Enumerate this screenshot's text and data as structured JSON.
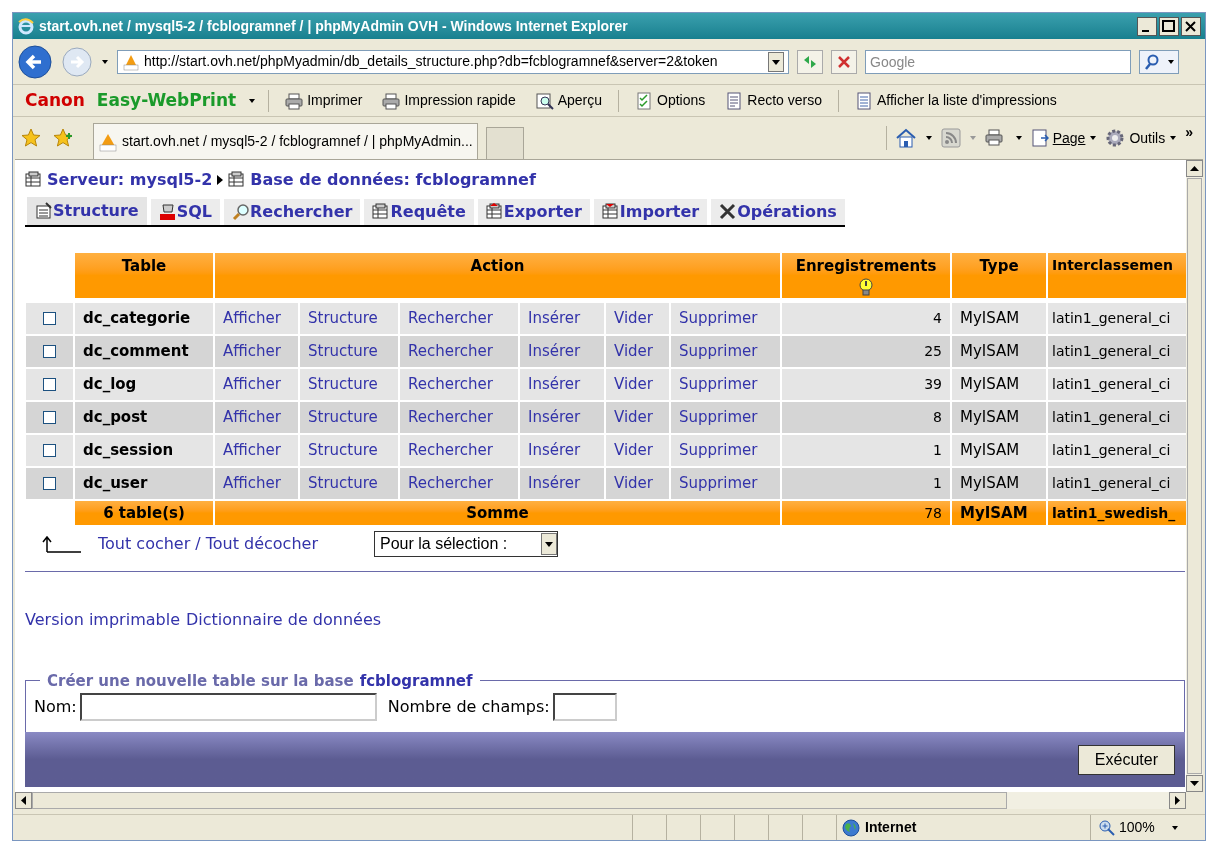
{
  "window": {
    "title": "start.ovh.net / mysql5-2 / fcblogramnef / | phpMyAdmin OVH - Windows Internet Explorer"
  },
  "address_bar": {
    "url": "http://start.ovh.net/phpMyadmin/db_details_structure.php?db=fcblogramnef&server=2&token"
  },
  "search": {
    "placeholder": "Google"
  },
  "print_toolbar": {
    "brand": "Canon",
    "product": "Easy-WebPrint",
    "buttons": [
      "Imprimer",
      "Impression rapide",
      "Aperçu",
      "Options",
      "Recto verso",
      "Afficher la liste d'impressions"
    ]
  },
  "browser_tabs": [
    {
      "label": "start.ovh.net / mysql5-2 / fcblogramnef / | phpMyAdmin...",
      "selected": true
    }
  ],
  "command_bar": {
    "page": "Page",
    "tools": "Outils",
    "more": "»"
  },
  "breadcrumb": {
    "server": "Serveur: mysql5-2",
    "database": "Base de données: fcblogramnef"
  },
  "pma_tabs": [
    {
      "label": "Structure",
      "selected": true
    },
    {
      "label": "SQL",
      "selected": false
    },
    {
      "label": "Rechercher",
      "selected": false
    },
    {
      "label": "Requête",
      "selected": false
    },
    {
      "label": "Exporter",
      "selected": false
    },
    {
      "label": "Importer",
      "selected": false
    },
    {
      "label": "Opérations",
      "selected": false
    }
  ],
  "table": {
    "columns": [
      "Table",
      "Action",
      "Enregistrements",
      "Type",
      "Interclassemen"
    ],
    "rows": [
      {
        "checked": false,
        "name": "dc_categorie",
        "actions": [
          "Afficher",
          "Structure",
          "Rechercher",
          "Insérer",
          "Vider",
          "Supprimer"
        ],
        "records": "4",
        "type": "MyISAM",
        "collation": "latin1_general_ci"
      },
      {
        "checked": false,
        "name": "dc_comment",
        "actions": [
          "Afficher",
          "Structure",
          "Rechercher",
          "Insérer",
          "Vider",
          "Supprimer"
        ],
        "records": "25",
        "type": "MyISAM",
        "collation": "latin1_general_ci"
      },
      {
        "checked": false,
        "name": "dc_log",
        "actions": [
          "Afficher",
          "Structure",
          "Rechercher",
          "Insérer",
          "Vider",
          "Supprimer"
        ],
        "records": "39",
        "type": "MyISAM",
        "collation": "latin1_general_ci"
      },
      {
        "checked": false,
        "name": "dc_post",
        "actions": [
          "Afficher",
          "Structure",
          "Rechercher",
          "Insérer",
          "Vider",
          "Supprimer"
        ],
        "records": "8",
        "type": "MyISAM",
        "collation": "latin1_general_ci"
      },
      {
        "checked": false,
        "name": "dc_session",
        "actions": [
          "Afficher",
          "Structure",
          "Rechercher",
          "Insérer",
          "Vider",
          "Supprimer"
        ],
        "records": "1",
        "type": "MyISAM",
        "collation": "latin1_general_ci"
      },
      {
        "checked": false,
        "name": "dc_user",
        "actions": [
          "Afficher",
          "Structure",
          "Rechercher",
          "Insérer",
          "Vider",
          "Supprimer"
        ],
        "records": "1",
        "type": "MyISAM",
        "collation": "latin1_general_ci"
      }
    ],
    "footer": {
      "count": "6 table(s)",
      "label": "Somme",
      "records": "78",
      "type": "MyISAM",
      "collation": "latin1_swedish_"
    }
  },
  "selection": {
    "check_all": "Tout cocher",
    "separator": "/",
    "uncheck_all": "Tout décocher",
    "select_value": "Pour la sélection :"
  },
  "links": [
    "Version imprimable",
    "Dictionnaire de données"
  ],
  "create_table": {
    "legend": "Créer une nouvelle table sur la base",
    "database": "fcblogramnef",
    "name_label": "Nom:",
    "fields_label": "Nombre de champs:",
    "button": "Exécuter"
  },
  "status_bar": {
    "zone": "Internet",
    "zoom": "100%"
  }
}
